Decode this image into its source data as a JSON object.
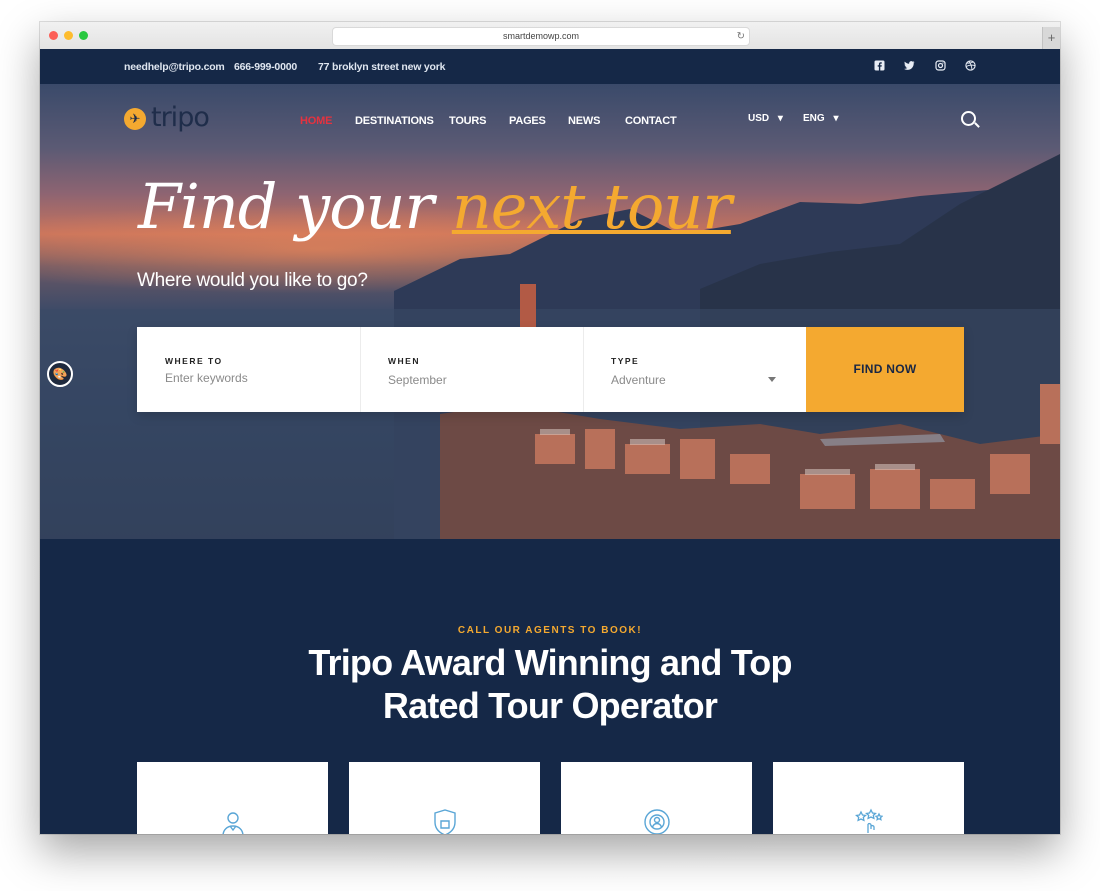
{
  "browser": {
    "url": "smartdemowp.com",
    "new_tab": "+"
  },
  "topbar": {
    "email": "needhelp@tripo.com",
    "phone": "666-999-0000",
    "address": "77 broklyn street new york"
  },
  "brand": {
    "name": "tripo"
  },
  "nav": {
    "items": [
      "HOME",
      "DESTINATIONS",
      "TOURS",
      "PAGES",
      "NEWS",
      "CONTACT"
    ],
    "currency": "USD",
    "language": "ENG"
  },
  "hero": {
    "headline_part1": "Find your ",
    "headline_accent": "next tour",
    "subhead": "Where would you like to go?"
  },
  "search": {
    "where_label": "WHERE TO",
    "where_placeholder": "Enter keywords",
    "when_label": "WHEN",
    "when_value": "September",
    "type_label": "TYPE",
    "type_value": "Adventure",
    "submit": "FIND NOW"
  },
  "section": {
    "eyebrow": "CALL OUR AGENTS TO BOOK!",
    "title_line1": "Tripo Award Winning and Top",
    "title_line2": "Rated Tour Operator"
  },
  "colors": {
    "navy": "#152847",
    "accent": "#f4a930",
    "active_nav": "#e5323f"
  }
}
